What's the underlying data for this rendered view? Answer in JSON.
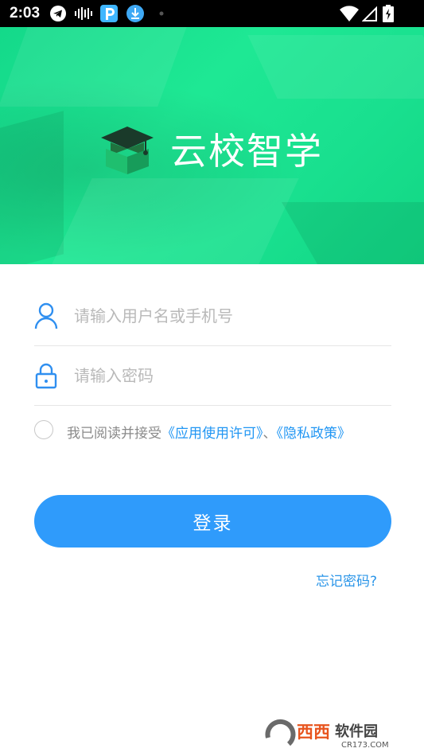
{
  "status_bar": {
    "time": "2:03",
    "icons": [
      "telegram-icon",
      "audio-wave-icon",
      "parking-app-icon",
      "download-icon",
      "dot-icon",
      "wifi-icon",
      "signal-icon",
      "battery-icon"
    ]
  },
  "hero": {
    "app_name": "云校智学",
    "logo_icon": "graduation-cap-book-icon",
    "colors": {
      "background": "#1ee894",
      "cap": "#1a3a2a",
      "book": "#1fbf6f"
    }
  },
  "login_form": {
    "username_placeholder": "请输入用户名或手机号",
    "password_placeholder": "请输入密码",
    "username_value": "",
    "password_value": "",
    "agreement": {
      "checked": false,
      "prefix": "我已阅读并接受",
      "license_link": "《应用使用许可》",
      "separator": "、",
      "privacy_link": "《隐私政策》"
    },
    "login_button": "登录",
    "forgot_password": "忘记密码?"
  },
  "watermark": {
    "text_main": "西西软件园",
    "text_sub": "CR173.COM"
  },
  "colors": {
    "accent_blue": "#2f9bfb",
    "link_blue": "#2196f3",
    "placeholder": "#b9b9b9",
    "divider": "#e6e6e6"
  }
}
